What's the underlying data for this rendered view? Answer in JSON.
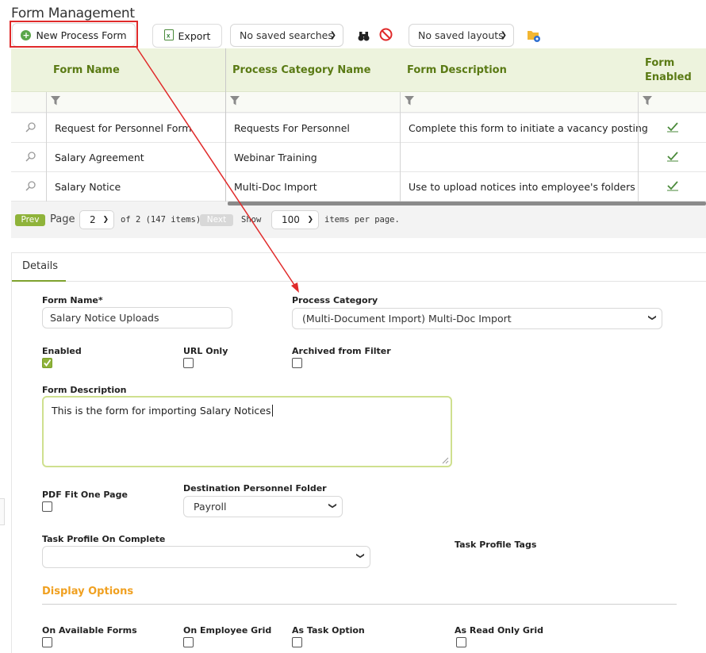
{
  "page": {
    "title": "Form Management"
  },
  "toolbar": {
    "new_label": "New Process Form",
    "export_label": "Export",
    "saved_searches": "No saved searches",
    "saved_layouts": "No saved layouts"
  },
  "grid": {
    "columns": [
      "Form Name",
      "Process Category Name",
      "Form Description",
      "Form",
      "Enabled"
    ],
    "rows": [
      {
        "name": "Request for Personnel Form",
        "category": "Requests For Personnel",
        "description": "Complete this form to initiate a vacancy posting"
      },
      {
        "name": "Salary Agreement",
        "category": "Webinar Training",
        "description": ""
      },
      {
        "name": "Salary Notice",
        "category": "Multi-Doc Import",
        "description": "Use to upload notices into employee's folders"
      }
    ]
  },
  "pager": {
    "prev": "Prev",
    "page_label": "Page",
    "page_value": "2",
    "of_text": "of 2 (147 items)",
    "next": "Next",
    "show_label": "Show",
    "page_size": "100",
    "per_page": "items per page."
  },
  "details": {
    "tab": "Details",
    "form_name_label": "Form Name*",
    "form_name_value": "Salary Notice Uploads",
    "process_category_label": "Process Category",
    "process_category_value": "(Multi-Document Import) Multi-Doc Import",
    "enabled_label": "Enabled",
    "url_only_label": "URL Only",
    "archived_label": "Archived from Filter",
    "form_description_label": "Form Description",
    "form_description_value": "This is the form for importing Salary Notices",
    "pdf_fit_label": "PDF Fit One Page",
    "destination_label": "Destination Personnel Folder",
    "destination_value": "Payroll",
    "task_profile_label": "Task Profile On Complete",
    "task_profile_value": "",
    "task_tags_label": "Task Profile Tags",
    "display_options_title": "Display Options",
    "on_available_label": "On Available Forms",
    "on_employee_grid_label": "On Employee Grid",
    "as_task_option_label": "As Task Option",
    "as_read_only_label": "As Read Only Grid"
  },
  "colors": {
    "accent": "#5a7a14",
    "highlight": "#e02a2a",
    "orange": "#f0a020"
  }
}
